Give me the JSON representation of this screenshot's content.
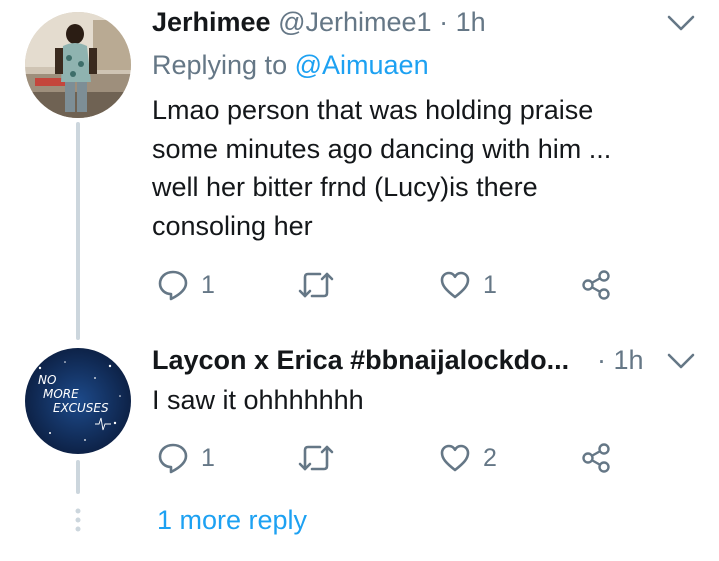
{
  "tweets": [
    {
      "name": "Jerhimee",
      "handle": "@Jerhimee1",
      "separator": "·",
      "time": "1h",
      "replying_prefix": "Replying to",
      "replying_to": "@Aimuaen",
      "body_lines": [
        "Lmao person that was holding praise",
        "some minutes ago dancing with him ...",
        "well her bitter frnd (Lucy)is there",
        "consoling her"
      ],
      "replies": "1",
      "retweets": "",
      "likes": "1"
    },
    {
      "name": "Laycon x Erica #bbnaijalockdo...",
      "separator": "·",
      "time": "1h",
      "avatar_text": [
        "NO",
        "MORE",
        "EXCUSES"
      ],
      "body_lines": [
        "I saw it ohhhhhhh"
      ],
      "replies": "1",
      "retweets": "",
      "likes": "2"
    }
  ],
  "more_replies": "1 more reply",
  "colors": {
    "accent": "#1da1f2",
    "secondary_text": "#657786",
    "thread_line": "#ccd6dd",
    "icon": "#657786"
  }
}
